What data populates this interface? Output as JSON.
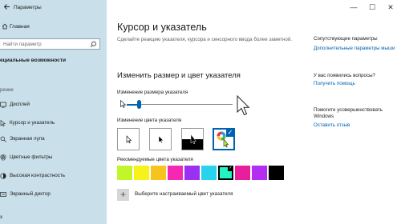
{
  "window": {
    "title": "Параметры",
    "controls": {
      "minimize": "—",
      "maximize": "☐",
      "close": "✕"
    }
  },
  "sidebar": {
    "home_label": "Главная",
    "search_placeholder": "Найти параметр",
    "section_title": "ециальные возможности",
    "group_label": "рение",
    "items": [
      {
        "label": "Дисплей",
        "icon": "display-icon"
      },
      {
        "label": "Курсор и указатель",
        "icon": "pointer-icon",
        "active": true
      },
      {
        "label": "Экранная лупа",
        "icon": "magnifier-icon"
      },
      {
        "label": "Цветные фильтры",
        "icon": "color-filter-icon"
      },
      {
        "label": "Высокая контрастность",
        "icon": "contrast-icon"
      },
      {
        "label": "Экранный диктор",
        "icon": "narrator-icon"
      },
      {
        "label": "х",
        "icon": "audio-icon"
      }
    ]
  },
  "main": {
    "title": "Курсор и указатель",
    "description": "Сделайте реакцию указателя, курсора и сенсорного ввода более заметной.",
    "section_title": "Изменить размер и цвет указателя",
    "size_label": "Изменение размера указателя",
    "size_value": 0.1,
    "color_label": "Изменение цвета указателя",
    "pointer_colors": [
      {
        "name": "white",
        "selected": false
      },
      {
        "name": "black",
        "selected": false
      },
      {
        "name": "inverted",
        "selected": false
      },
      {
        "name": "custom",
        "selected": true
      }
    ],
    "recommended_label": "Рекомендуемые цвета указателя",
    "recommended_colors": [
      "#c3f52b",
      "#f7f21a",
      "#f7c31e",
      "#f527b3",
      "#9a30f2",
      "#28d3ee",
      "#22f5c3",
      "#e81e9d",
      "#b32ef0",
      "#000000"
    ],
    "selected_color_index": 6,
    "custom_label": "Выберите настраиваемый цвет указателя"
  },
  "related": {
    "title": "Сопутствующие параметры",
    "link": "Дополнительные параметры мыши",
    "question_title": "У вас появились вопросы?",
    "help_link": "Получить помощь",
    "improve_title": "Помогите усовершенствовать Windows",
    "feedback_link": "Оставить отзыв"
  },
  "accent_color": "#0063b1"
}
